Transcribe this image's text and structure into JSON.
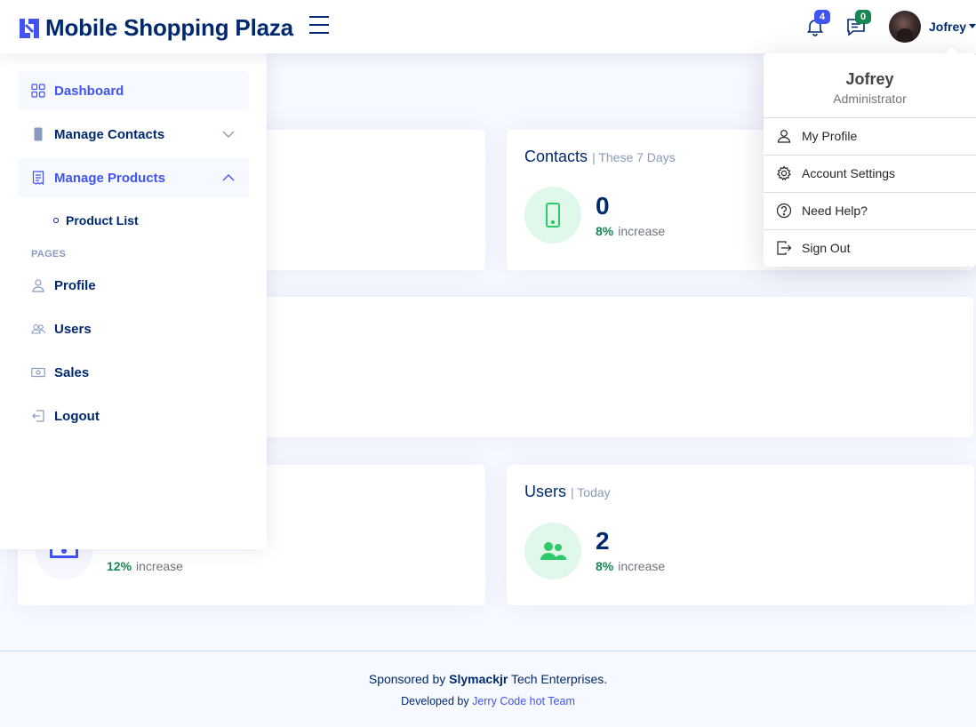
{
  "header": {
    "brand": "Mobile Shopping Plaza",
    "notifications_count": "4",
    "messages_count": "0",
    "user_name": "Jofrey"
  },
  "sidebar": {
    "items": [
      {
        "label": "Dashboard"
      },
      {
        "label": "Manage Contacts"
      },
      {
        "label": "Manage Products"
      }
    ],
    "sub_items": [
      {
        "label": "Product List"
      }
    ],
    "pages_heading": "PAGES",
    "pages": [
      {
        "label": "Profile"
      },
      {
        "label": "Users"
      },
      {
        "label": "Sales"
      },
      {
        "label": "Logout"
      }
    ]
  },
  "cards": {
    "contacts": {
      "title": "Contacts",
      "period": "| These 7 Days",
      "value": "0",
      "pct": "8%",
      "pct_label": "increase"
    },
    "sales": {
      "pct": "12%",
      "pct_label": "increase"
    },
    "users": {
      "title": "Users",
      "period": "| Today",
      "value": "2",
      "pct": "8%",
      "pct_label": "increase"
    }
  },
  "profile_dropdown": {
    "name": "Jofrey",
    "role": "Administrator",
    "items": [
      {
        "label": "My Profile"
      },
      {
        "label": "Account Settings"
      },
      {
        "label": "Need Help?"
      },
      {
        "label": "Sign Out"
      }
    ]
  },
  "footer": {
    "sponsored_prefix": "Sponsored by",
    "sponsor": "Slymackjr",
    "sponsored_suffix": "Tech Enterprises.",
    "developed_prefix": "Developed by",
    "developer": "Jerry Code hot Team"
  },
  "colors": {
    "brand": "#012970",
    "accent": "#4154f1",
    "success": "#198754",
    "background": "#f6f9ff"
  }
}
